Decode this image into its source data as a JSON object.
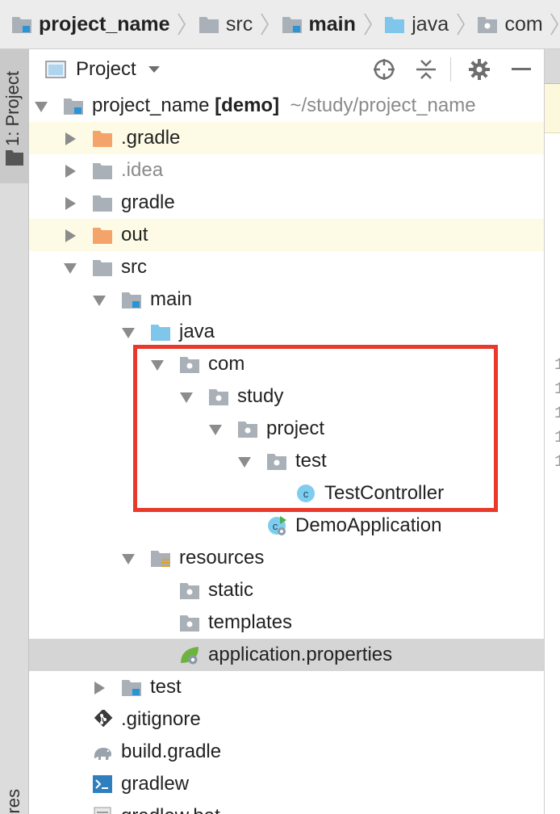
{
  "breadcrumb": [
    "project_name",
    "src",
    "main",
    "java",
    "com"
  ],
  "left_stripe": {
    "project_tab_label": "1: Project",
    "bottom_tab_label": "res"
  },
  "panel": {
    "view_selector_label": "Project"
  },
  "tree": {
    "root": {
      "name": "project_name",
      "module": "[demo]",
      "path": "~/study/project_name"
    },
    "gradle_hidden": ".gradle",
    "idea": ".idea",
    "gradle": "gradle",
    "out": "out",
    "src": "src",
    "main": "main",
    "java": "java",
    "com": "com",
    "study": "study",
    "project": "project",
    "test_pkg": "test",
    "test_controller": "TestController",
    "demo_application": "DemoApplication",
    "resources": "resources",
    "static": "static",
    "templates": "templates",
    "application_properties": "application.properties",
    "test_dir": "test",
    "gitignore": ".gitignore",
    "build_gradle": "build.gradle",
    "gradlew": "gradlew",
    "gradlew_bat": "gradlew.bat"
  },
  "editor": {
    "line_numbers": [
      "1",
      "1",
      "1",
      "1",
      "1"
    ]
  },
  "colors": {
    "highlight_box": "#e8392a",
    "excluded_folder": "#f4a46a",
    "source_folder": "#7fc6ea",
    "folder": "#a9b0b7",
    "selected_row": "#d5d5d5",
    "hl_row": "#fdfbe5"
  }
}
